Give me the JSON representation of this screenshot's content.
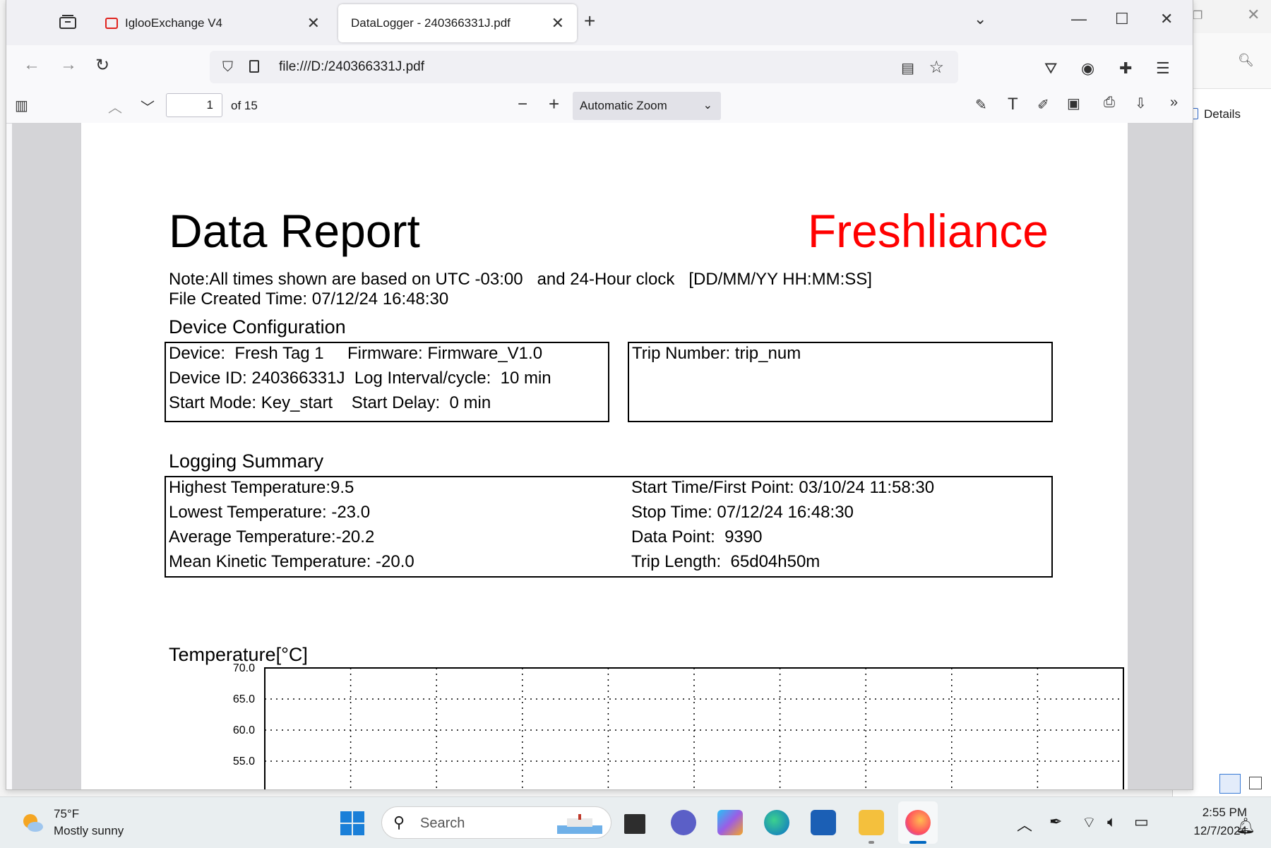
{
  "browser": {
    "tabs": [
      {
        "label": "IglooExchange V4",
        "active": false
      },
      {
        "label": "DataLogger - 240366331J.pdf",
        "active": true
      }
    ],
    "url": "file:///D:/240366331J.pdf"
  },
  "pdf_toolbar": {
    "page_number": "1",
    "page_count_label": "of 15",
    "zoom_label": "Automatic Zoom"
  },
  "side_panel": {
    "details_label": "Details"
  },
  "report": {
    "title": "Data Report",
    "brand": "Freshliance",
    "note": "Note:All times shown are based on UTC -03:00   and 24-Hour clock   [DD/MM/YY HH:MM:SS]",
    "file_created": "File Created Time: 07/12/24 16:48:30",
    "device_section_title": "Device Configuration",
    "device_lines": [
      "Device:  Fresh Tag 1     Firmware: Firmware_V1.0",
      "Device ID: 240366331J  Log Interval/cycle:  10 min",
      "Start Mode: Key_start    Start Delay:  0 min"
    ],
    "trip_number": "Trip Number: trip_num",
    "logging_section_title": "Logging Summary",
    "summary_left": [
      "Highest Temperature:9.5",
      "Lowest Temperature: -23.0",
      "Average Temperature:-20.2",
      "Mean Kinetic Temperature: -20.0"
    ],
    "summary_right": [
      "Start Time/First Point: 03/10/24 11:58:30",
      "Stop Time: 07/12/24 16:48:30",
      "Data Point:  9390",
      "Trip Length:  65d04h50m"
    ],
    "chart_title": "Temperature[°C]"
  },
  "chart_data": {
    "type": "line",
    "title": "Temperature[°C]",
    "y_ticks": [
      "70.0",
      "65.0",
      "60.0",
      "55.0"
    ],
    "ylim": [
      55,
      70
    ],
    "grid": true
  },
  "taskbar": {
    "weather_temp": "75°F",
    "weather_desc": "Mostly sunny",
    "search_placeholder": "Search",
    "time": "2:55 PM",
    "date": "12/7/2024"
  }
}
